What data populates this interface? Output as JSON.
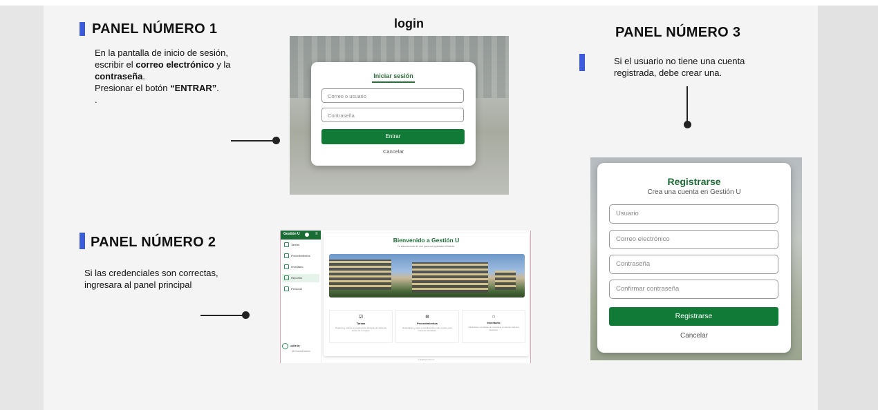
{
  "panel1": {
    "title": "PANEL NÚMERO 1",
    "line1": "En la pantalla de inicio de sesión,",
    "line2_pre": "escribir el ",
    "line2_bold": "correo electrónico",
    "line2_post": " y la",
    "line3_bold": "contraseña",
    "line3_post": ".",
    "line4_pre": "Presionar el botón ",
    "line4_bold": "“ENTRAR”",
    "line4_post": ".",
    "line5": "."
  },
  "panel2": {
    "title": "PANEL NÚMERO 2",
    "line1": "Si las credenciales son correctas,",
    "line2": "ingresara al panel principal"
  },
  "panel3": {
    "title": "PANEL NÚMERO 3",
    "line1": "Si el usuario no tiene una cuenta",
    "line2": "registrada, debe crear una."
  },
  "login_heading": "login",
  "login": {
    "title": "Iniciar sesión",
    "user_placeholder": "Correo o usuario",
    "password_placeholder": "Contraseña",
    "submit": "Entrar",
    "cancel": "Cancelar"
  },
  "dashboard": {
    "brand": "Gestión U",
    "menu_icon": "≡",
    "nav": [
      "Tareas",
      "Procedimientos",
      "Inventario",
      "Reportes",
      "Personal"
    ],
    "active_index": 3,
    "user": "admin",
    "user_sub": "Mi Cuenta Admin",
    "welcome": "Bienvenido a Gestión U",
    "welcome_sub": "Tu solución todo en uno para una operación eficiente.",
    "cards": [
      {
        "icon": "clipboard-icon",
        "glyph": "☑",
        "title": "Tareas",
        "desc": "Organiza y realiza un seguimiento eficiente de todas las tareas de tu equipo."
      },
      {
        "icon": "hierarchy-icon",
        "glyph": "⚙",
        "title": "Procedimientos",
        "desc": "Estandariza y sigue procedimientos paso a paso para mantener la calidad."
      },
      {
        "icon": "warehouse-icon",
        "glyph": "⌂",
        "title": "Inventario",
        "desc": "Administra y monitorea tu inventario en tiempo real con precisión."
      }
    ],
    "footer": "© 2025 Gestión U"
  },
  "register": {
    "title": "Registrarse",
    "subtitle": "Crea una cuenta en Gestión U",
    "fields": [
      "Usuario",
      "Correo electrónico",
      "Contraseña",
      "Confirmar contraseña"
    ],
    "submit": "Registrarse",
    "cancel": "Cancelar"
  },
  "colors": {
    "marker": "#3b5bdb",
    "brand_green": "#117a36"
  }
}
